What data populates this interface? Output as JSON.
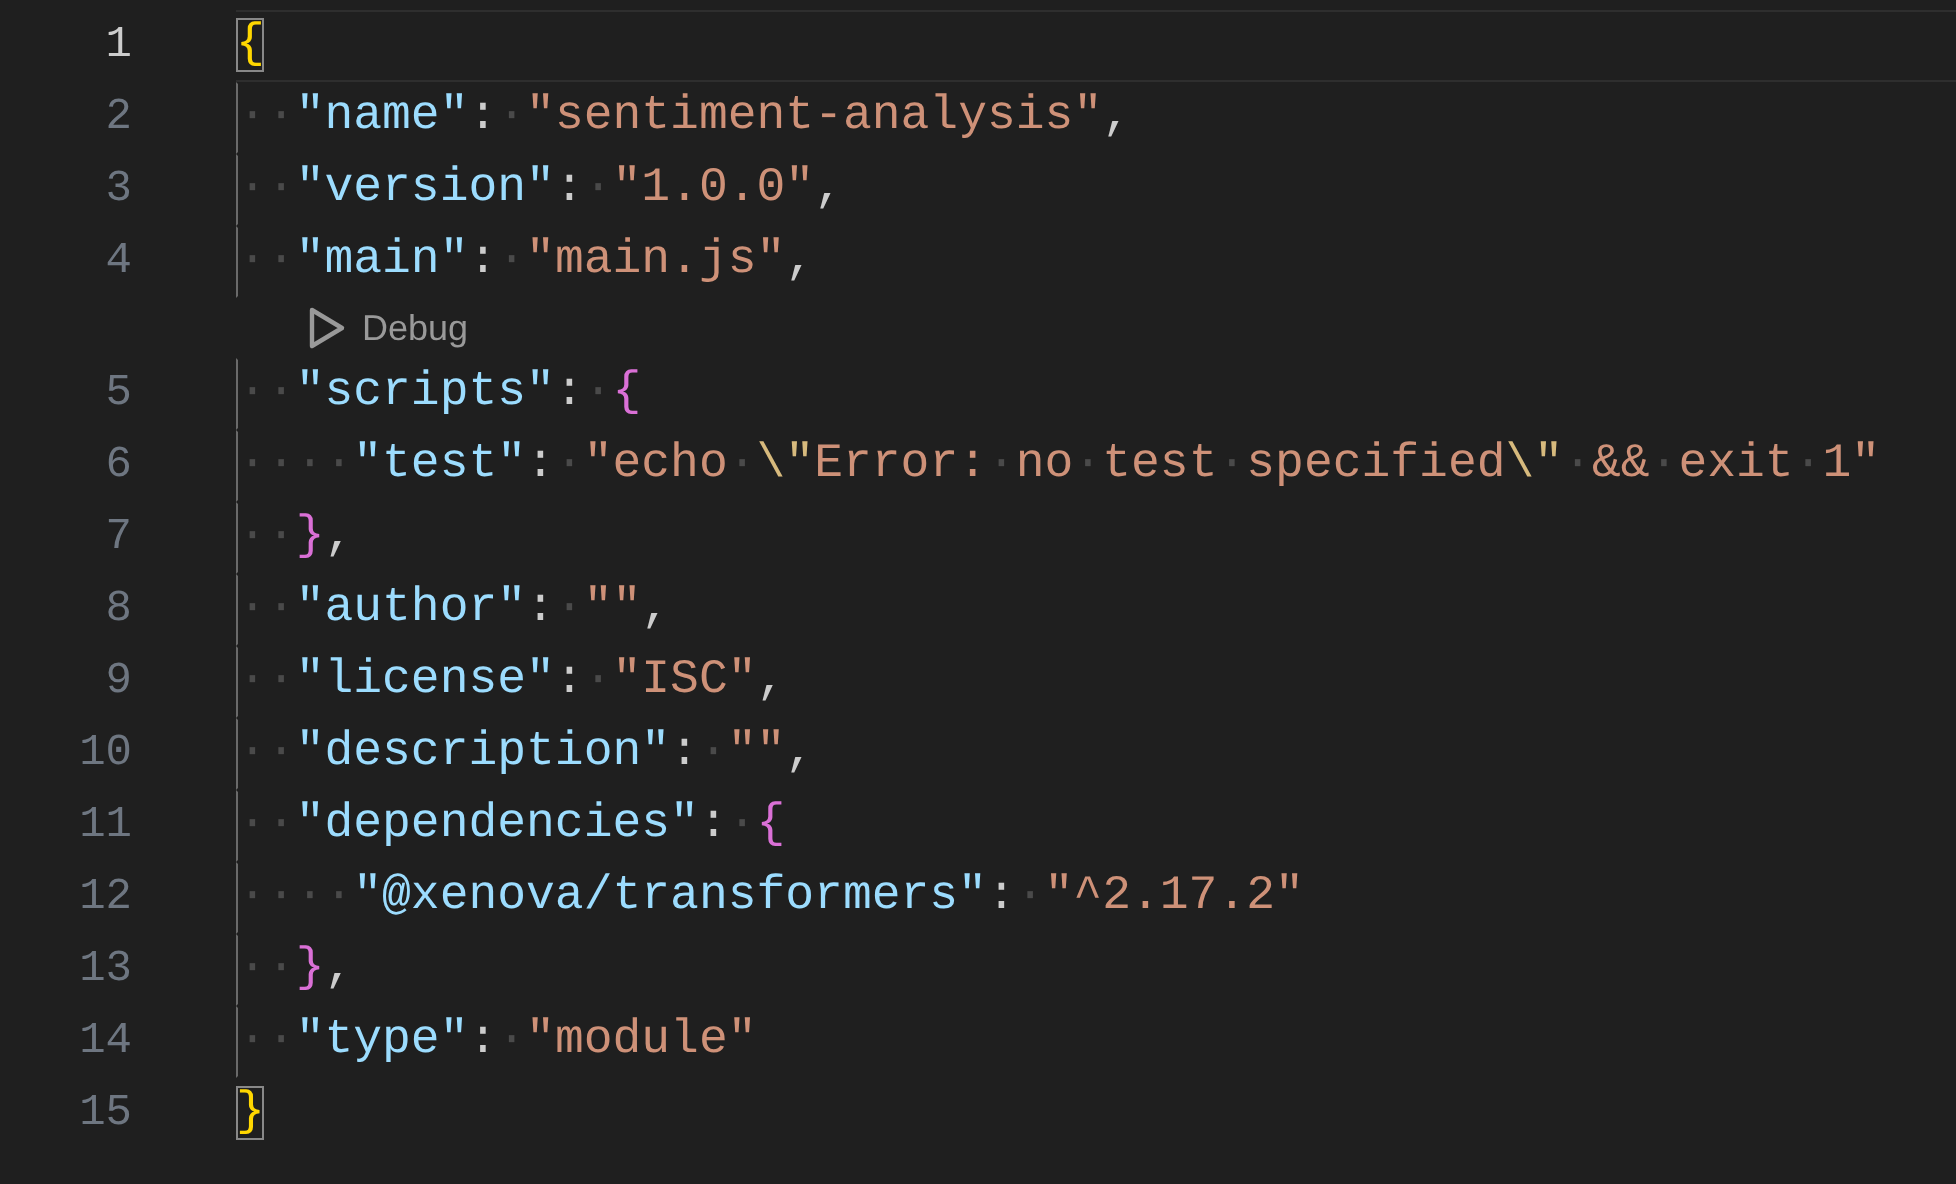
{
  "editor": {
    "lines": [
      {
        "kind": "code",
        "number": "1",
        "current": true,
        "tokens": [
          {
            "kind": "bracket",
            "text": "{",
            "color": "#ffd700",
            "matched": true
          }
        ]
      },
      {
        "kind": "code",
        "number": "2",
        "current": false,
        "tokens": [
          {
            "kind": "ws",
            "text": "··"
          },
          {
            "kind": "key",
            "text": "\"name\""
          },
          {
            "kind": "punct",
            "text": ":"
          },
          {
            "kind": "ws",
            "text": "·"
          },
          {
            "kind": "string",
            "text": "\"sentiment-analysis\""
          },
          {
            "kind": "punct",
            "text": ","
          }
        ]
      },
      {
        "kind": "code",
        "number": "3",
        "current": false,
        "tokens": [
          {
            "kind": "ws",
            "text": "··"
          },
          {
            "kind": "key",
            "text": "\"version\""
          },
          {
            "kind": "punct",
            "text": ":"
          },
          {
            "kind": "ws",
            "text": "·"
          },
          {
            "kind": "string",
            "text": "\"1.0.0\""
          },
          {
            "kind": "punct",
            "text": ","
          }
        ]
      },
      {
        "kind": "code",
        "number": "4",
        "current": false,
        "tokens": [
          {
            "kind": "ws",
            "text": "··"
          },
          {
            "kind": "key",
            "text": "\"main\""
          },
          {
            "kind": "punct",
            "text": ":"
          },
          {
            "kind": "ws",
            "text": "·"
          },
          {
            "kind": "string",
            "text": "\"main.js\""
          },
          {
            "kind": "punct",
            "text": ","
          }
        ]
      },
      {
        "kind": "codelens",
        "label": "Debug"
      },
      {
        "kind": "code",
        "number": "5",
        "current": false,
        "tokens": [
          {
            "kind": "ws",
            "text": "··"
          },
          {
            "kind": "key",
            "text": "\"scripts\""
          },
          {
            "kind": "punct",
            "text": ":"
          },
          {
            "kind": "ws",
            "text": "·"
          },
          {
            "kind": "bracket",
            "text": "{",
            "color": "#da70d6",
            "matched": false
          }
        ]
      },
      {
        "kind": "code",
        "number": "6",
        "current": false,
        "tokens": [
          {
            "kind": "ws",
            "text": "····"
          },
          {
            "kind": "key",
            "text": "\"test\""
          },
          {
            "kind": "punct",
            "text": ":"
          },
          {
            "kind": "ws",
            "text": "·"
          },
          {
            "kind": "string",
            "text": "\"echo"
          },
          {
            "kind": "ws",
            "text": "·"
          },
          {
            "kind": "escape",
            "text": "\\\""
          },
          {
            "kind": "string",
            "text": "Error:"
          },
          {
            "kind": "ws",
            "text": "·"
          },
          {
            "kind": "string",
            "text": "no"
          },
          {
            "kind": "ws",
            "text": "·"
          },
          {
            "kind": "string",
            "text": "test"
          },
          {
            "kind": "ws",
            "text": "·"
          },
          {
            "kind": "string",
            "text": "specified"
          },
          {
            "kind": "escape",
            "text": "\\\""
          },
          {
            "kind": "ws",
            "text": "·"
          },
          {
            "kind": "string",
            "text": "&&"
          },
          {
            "kind": "ws",
            "text": "·"
          },
          {
            "kind": "string",
            "text": "exit"
          },
          {
            "kind": "ws",
            "text": "·"
          },
          {
            "kind": "string",
            "text": "1\""
          }
        ]
      },
      {
        "kind": "code",
        "number": "7",
        "current": false,
        "tokens": [
          {
            "kind": "ws",
            "text": "··"
          },
          {
            "kind": "bracket",
            "text": "}",
            "color": "#da70d6",
            "matched": false
          },
          {
            "kind": "punct",
            "text": ","
          }
        ]
      },
      {
        "kind": "code",
        "number": "8",
        "current": false,
        "tokens": [
          {
            "kind": "ws",
            "text": "··"
          },
          {
            "kind": "key",
            "text": "\"author\""
          },
          {
            "kind": "punct",
            "text": ":"
          },
          {
            "kind": "ws",
            "text": "·"
          },
          {
            "kind": "string",
            "text": "\"\""
          },
          {
            "kind": "punct",
            "text": ","
          }
        ]
      },
      {
        "kind": "code",
        "number": "9",
        "current": false,
        "tokens": [
          {
            "kind": "ws",
            "text": "··"
          },
          {
            "kind": "key",
            "text": "\"license\""
          },
          {
            "kind": "punct",
            "text": ":"
          },
          {
            "kind": "ws",
            "text": "·"
          },
          {
            "kind": "string",
            "text": "\"ISC\""
          },
          {
            "kind": "punct",
            "text": ","
          }
        ]
      },
      {
        "kind": "code",
        "number": "10",
        "current": false,
        "tokens": [
          {
            "kind": "ws",
            "text": "··"
          },
          {
            "kind": "key",
            "text": "\"description\""
          },
          {
            "kind": "punct",
            "text": ":"
          },
          {
            "kind": "ws",
            "text": "·"
          },
          {
            "kind": "string",
            "text": "\"\""
          },
          {
            "kind": "punct",
            "text": ","
          }
        ]
      },
      {
        "kind": "code",
        "number": "11",
        "current": false,
        "tokens": [
          {
            "kind": "ws",
            "text": "··"
          },
          {
            "kind": "key",
            "text": "\"dependencies\""
          },
          {
            "kind": "punct",
            "text": ":"
          },
          {
            "kind": "ws",
            "text": "·"
          },
          {
            "kind": "bracket",
            "text": "{",
            "color": "#da70d6",
            "matched": false
          }
        ]
      },
      {
        "kind": "code",
        "number": "12",
        "current": false,
        "tokens": [
          {
            "kind": "ws",
            "text": "····"
          },
          {
            "kind": "key",
            "text": "\"@xenova/transformers\""
          },
          {
            "kind": "punct",
            "text": ":"
          },
          {
            "kind": "ws",
            "text": "·"
          },
          {
            "kind": "string",
            "text": "\"^2.17.2\""
          }
        ]
      },
      {
        "kind": "code",
        "number": "13",
        "current": false,
        "tokens": [
          {
            "kind": "ws",
            "text": "··"
          },
          {
            "kind": "bracket",
            "text": "}",
            "color": "#da70d6",
            "matched": false
          },
          {
            "kind": "punct",
            "text": ","
          }
        ]
      },
      {
        "kind": "code",
        "number": "14",
        "current": false,
        "tokens": [
          {
            "kind": "ws",
            "text": "··"
          },
          {
            "kind": "key",
            "text": "\"type\""
          },
          {
            "kind": "punct",
            "text": ":"
          },
          {
            "kind": "ws",
            "text": "·"
          },
          {
            "kind": "string",
            "text": "\"module\""
          }
        ]
      },
      {
        "kind": "code",
        "number": "15",
        "current": false,
        "tokens": [
          {
            "kind": "bracket",
            "text": "}",
            "color": "#ffd700",
            "matched": true
          }
        ]
      }
    ]
  }
}
